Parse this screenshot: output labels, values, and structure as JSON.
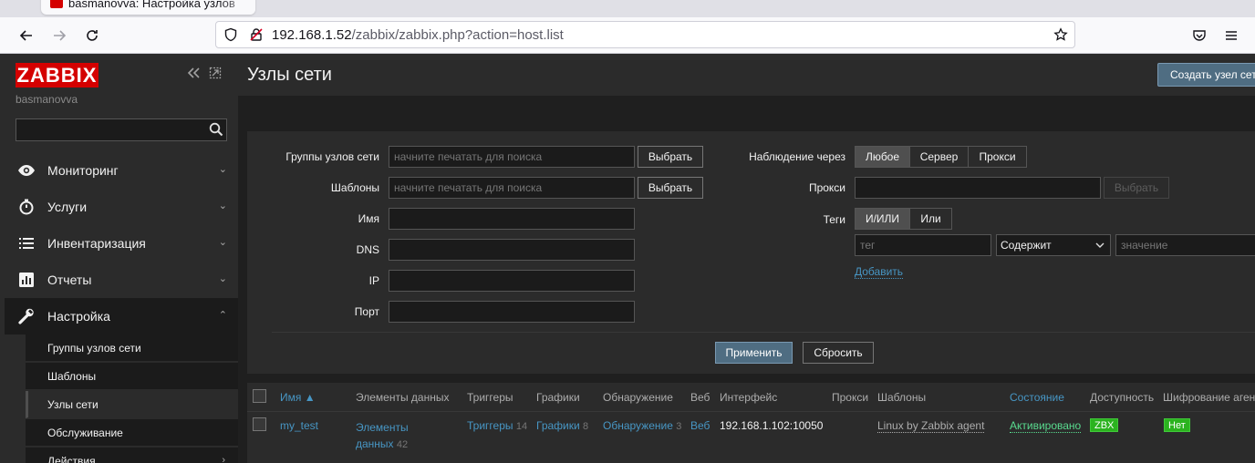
{
  "browser": {
    "tab_title": "basmanovva: Настройка узлов",
    "url_host": "192.168.1.52",
    "url_path": "/zabbix/zabbix.php?action=host.list"
  },
  "sidebar": {
    "logo": "ZABBIX",
    "username": "basmanovva",
    "search_value": "",
    "menu": [
      {
        "label": "Мониторинг",
        "icon": "eye-icon"
      },
      {
        "label": "Услуги",
        "icon": "clock-icon"
      },
      {
        "label": "Инвентаризация",
        "icon": "list-icon"
      },
      {
        "label": "Отчеты",
        "icon": "bar-chart-icon"
      },
      {
        "label": "Настройка",
        "icon": "wrench-icon"
      }
    ],
    "submenu": [
      {
        "label": "Группы узлов сети"
      },
      {
        "label": "Шаблоны"
      },
      {
        "label": "Узлы сети"
      },
      {
        "label": "Обслуживание"
      },
      {
        "label": "Действия"
      }
    ]
  },
  "header": {
    "title": "Узлы сети",
    "create_button": "Создать узел сети"
  },
  "filter": {
    "host_groups_label": "Группы узлов сети",
    "host_groups_placeholder": "начните печатать для поиска",
    "templates_label": "Шаблоны",
    "templates_placeholder": "начните печатать для поиска",
    "select_button": "Выбрать",
    "name_label": "Имя",
    "dns_label": "DNS",
    "ip_label": "IP",
    "port_label": "Порт",
    "monitored_by_label": "Наблюдение через",
    "monitored_by_options": [
      "Любое",
      "Сервер",
      "Прокси"
    ],
    "proxy_label": "Прокси",
    "tags_label": "Теги",
    "tags_options": [
      "И/ИЛИ",
      "Или"
    ],
    "tag_placeholder": "тег",
    "tag_operator": "Содержит",
    "tag_value_placeholder": "значение",
    "add_link": "Добавить",
    "apply_button": "Применить",
    "reset_button": "Сбросить"
  },
  "table": {
    "headers": {
      "name": "Имя ▲",
      "items": "Элементы данных",
      "triggers": "Триггеры",
      "graphs": "Графики",
      "discovery": "Обнаружение",
      "web": "Веб",
      "interface": "Интерфейс",
      "proxy": "Прокси",
      "templates": "Шаблоны",
      "status": "Состояние",
      "availability": "Доступность",
      "encryption": "Шифрование агента"
    },
    "row": {
      "name": "my_test",
      "items_label_1": "Элементы",
      "items_label_2": "данных",
      "items_count": "42",
      "triggers_label": "Триггеры",
      "triggers_count": "14",
      "graphs_label": "Графики",
      "graphs_count": "8",
      "discovery_label": "Обнаружение",
      "discovery_count": "3",
      "web_label": "Веб",
      "interface": "192.168.1.102:10050",
      "template": "Linux by Zabbix agent",
      "status": "Активировано",
      "availability_badge": "ZBX",
      "encryption_badge": "Нет"
    }
  }
}
